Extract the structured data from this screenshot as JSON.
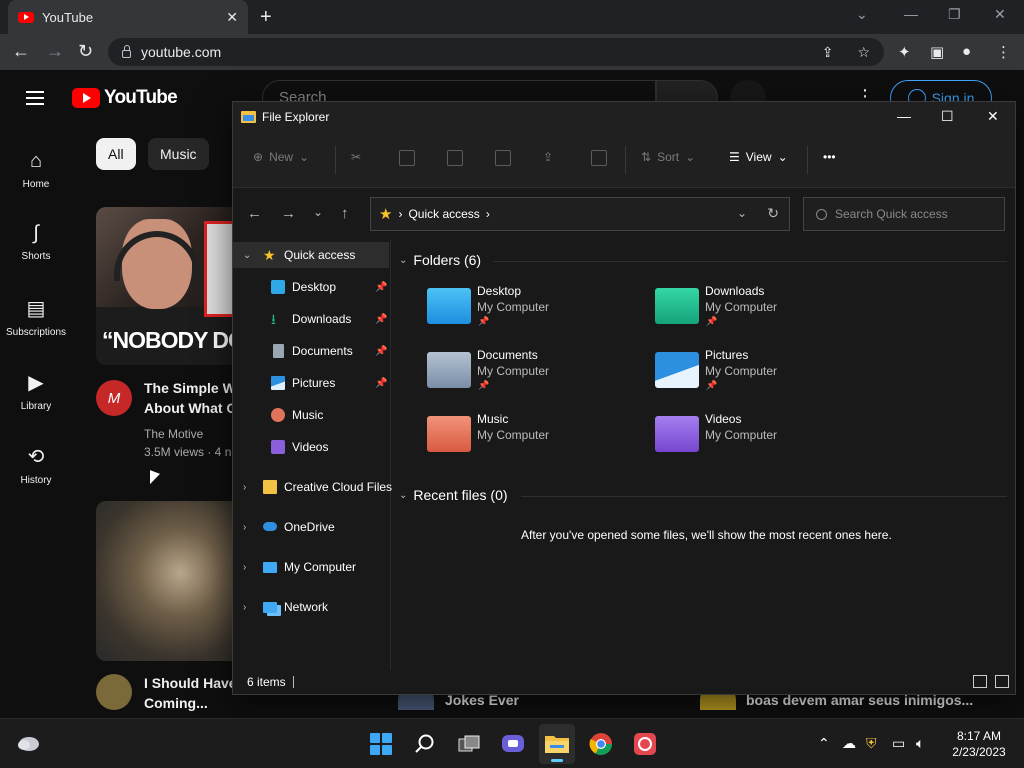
{
  "chrome": {
    "tab_title": "YouTube",
    "tab_close": "✕",
    "new_tab": "+",
    "url": "youtube.com"
  },
  "youtube": {
    "search_placeholder": "Search",
    "sign_in": "Sign in",
    "sidebar": [
      {
        "label": "Home",
        "icon": "home-icon"
      },
      {
        "label": "Shorts",
        "icon": "shorts-icon"
      },
      {
        "label": "Subscriptions",
        "icon": "subscriptions-icon"
      },
      {
        "label": "Library",
        "icon": "library-icon"
      },
      {
        "label": "History",
        "icon": "history-icon"
      }
    ],
    "chips": [
      "All",
      "Music"
    ],
    "thumb1_caption": "“NOBODY DOES",
    "video1": {
      "title_line1": "The Simple Wa",
      "title_line2": "About What O",
      "channel": "The Motive",
      "meta": "3.5M views · 4 n",
      "avatar_letter": "M"
    },
    "video2": {
      "title_line1": "I Should Have",
      "title_line2": "Coming..."
    },
    "bottom_titles": [
      "Jokes Ever",
      "boas devem amar seus inimigos..."
    ]
  },
  "explorer": {
    "title": "File Explorer",
    "commands": {
      "new": "New",
      "sort": "Sort",
      "view": "View",
      "more": "•••"
    },
    "address": {
      "location": "Quick access"
    },
    "search_placeholder": "Search Quick access",
    "sidebar": {
      "quick_access": "Quick access",
      "pinned": [
        "Desktop",
        "Downloads",
        "Documents",
        "Pictures"
      ],
      "unpinned": [
        "Music",
        "Videos"
      ],
      "roots": [
        "Creative Cloud Files",
        "OneDrive",
        "My Computer",
        "Network"
      ]
    },
    "folders_header": "Folders (6)",
    "folders": [
      {
        "name": "Desktop",
        "location": "My Computer",
        "pinned": true,
        "color": "#2fa8e8"
      },
      {
        "name": "Downloads",
        "location": "My Computer",
        "pinned": true,
        "color": "#1fb38a"
      },
      {
        "name": "Documents",
        "location": "My Computer",
        "pinned": true,
        "color": "#8aa0b8"
      },
      {
        "name": "Pictures",
        "location": "My Computer",
        "pinned": true,
        "color": "#2d8fe0"
      },
      {
        "name": "Music",
        "location": "My Computer",
        "pinned": false,
        "color": "#e0735a"
      },
      {
        "name": "Videos",
        "location": "My Computer",
        "pinned": false,
        "color": "#8b5fd9"
      }
    ],
    "recent_header": "Recent files (0)",
    "recent_empty": "After you've opened some files, we'll show the most recent ones here.",
    "status_count": "6 items"
  },
  "taskbar": {
    "time": "8:17 AM",
    "date": "2/23/2023"
  }
}
